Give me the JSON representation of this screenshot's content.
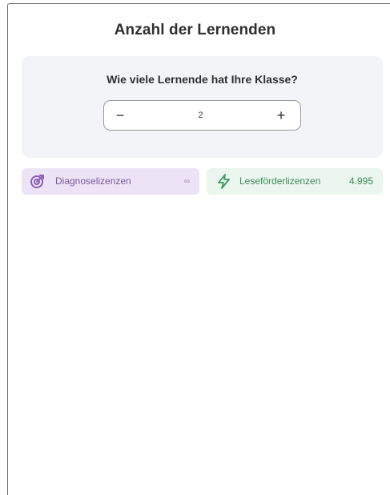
{
  "header": {
    "title": "Anzahl der Lernenden"
  },
  "question_card": {
    "question": "Wie viele Lernende hat Ihre Klasse?",
    "stepper": {
      "decrement_label": "−",
      "value": "2",
      "increment_label": "+"
    }
  },
  "licenses": [
    {
      "icon": "target-icon",
      "label": "Diagnoselizenzen",
      "count": "∞",
      "color": "#7a5a99",
      "background": "#ece3f6"
    },
    {
      "icon": "lightning-icon",
      "label": "Leseförderlizenzen",
      "count": "4.995",
      "color": "#3f8a5c",
      "background": "#eaf6ee"
    }
  ]
}
